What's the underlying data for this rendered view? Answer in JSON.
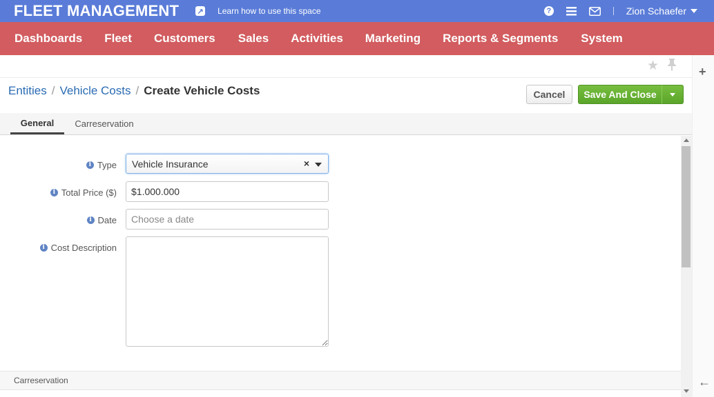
{
  "topbar": {
    "app_title": "FLEET MANAGEMENT",
    "learn_link": "Learn how to use this space",
    "user_name": "Zion Schaefer",
    "icons": [
      "share-icon",
      "help-icon",
      "list-icon",
      "mail-icon"
    ],
    "color": "#5a7cd8"
  },
  "mainnav": {
    "color": "#d25c5f",
    "items": [
      "Dashboards",
      "Fleet",
      "Customers",
      "Sales",
      "Activities",
      "Marketing",
      "Reports & Segments",
      "System"
    ]
  },
  "breadcrumb": {
    "items": [
      "Entities",
      "Vehicle Costs"
    ],
    "current": "Create Vehicle Costs",
    "separator": "/"
  },
  "actions": {
    "cancel_label": "Cancel",
    "save_label": "Save And Close"
  },
  "tabs": [
    {
      "label": "General",
      "active": true
    },
    {
      "label": "Carreservation",
      "active": false
    }
  ],
  "form": {
    "type": {
      "label": "Type",
      "value": "Vehicle Insurance"
    },
    "total_price": {
      "label": "Total Price ($)",
      "value": "$1.000.000"
    },
    "date": {
      "label": "Date",
      "value": "",
      "placeholder": "Choose a date"
    },
    "cost_description": {
      "label": "Cost Description",
      "value": ""
    }
  },
  "sections": {
    "carreservation_title": "Carreservation"
  }
}
